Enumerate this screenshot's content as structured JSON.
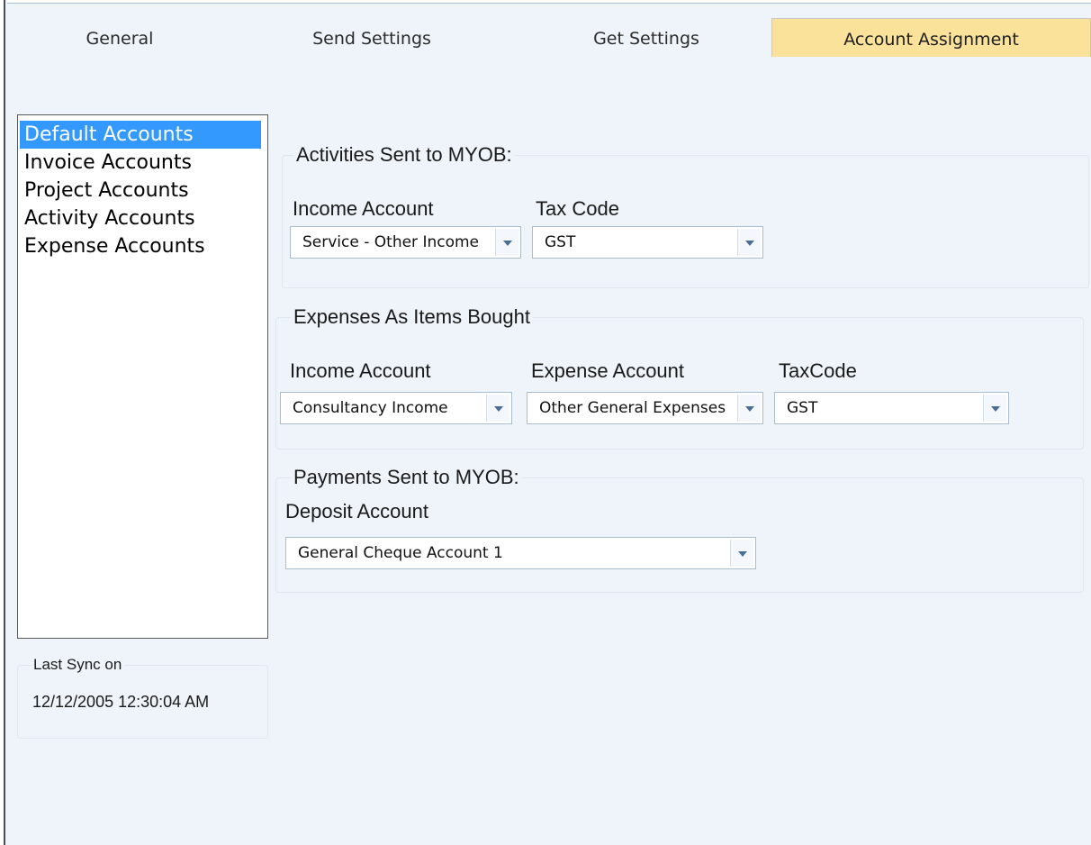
{
  "tabs": [
    {
      "label": "General",
      "active": false
    },
    {
      "label": "Send Settings",
      "active": false
    },
    {
      "label": "Get Settings",
      "active": false
    },
    {
      "label": "Account Assignment",
      "active": true
    }
  ],
  "account_types": {
    "items": [
      "Default Accounts",
      "Invoice Accounts",
      "Project Accounts",
      "Activity Accounts",
      "Expense Accounts"
    ],
    "selected": "Default Accounts"
  },
  "activities_group": {
    "title": "Activities Sent to MYOB:",
    "income_account_label": "Income Account",
    "income_account_value": "Service - Other Income",
    "tax_code_label": "Tax Code",
    "tax_code_value": "GST"
  },
  "expenses_group": {
    "title": "Expenses As Items Bought",
    "income_account_label": "Income Account",
    "income_account_value": "Consultancy Income",
    "expense_account_label": "Expense Account",
    "expense_account_value": "Other General Expenses",
    "tax_code_label": "TaxCode",
    "tax_code_value": "GST"
  },
  "payments_group": {
    "title": "Payments Sent to MYOB:",
    "deposit_account_label": "Deposit Account",
    "deposit_account_value": "General Cheque Account 1"
  },
  "last_sync": {
    "label": "Last Sync on",
    "value": "12/12/2005 12:30:04 AM"
  },
  "colors": {
    "background": "#eef4fa",
    "active_tab": "#fbe29a",
    "selection": "#3399ff",
    "dropdown_arrow": "#4a6d95"
  }
}
